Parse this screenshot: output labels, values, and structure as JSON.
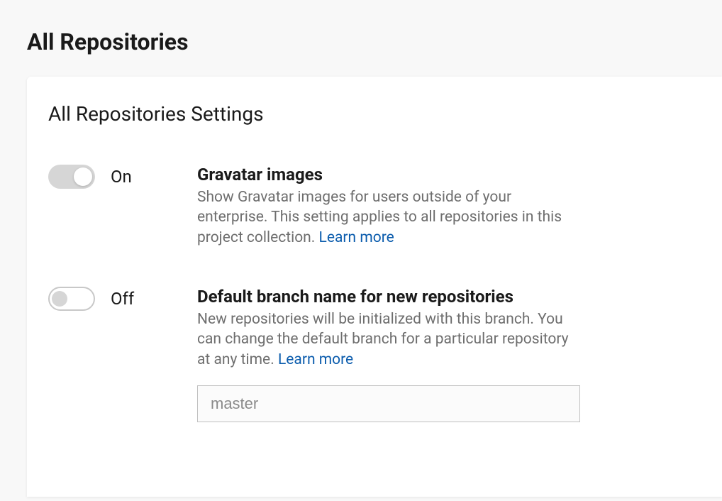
{
  "page": {
    "title": "All Repositories"
  },
  "card": {
    "title": "All Repositories Settings"
  },
  "settings": {
    "gravatar": {
      "toggle_state": "On",
      "title": "Gravatar images",
      "description": "Show Gravatar images for users outside of your enterprise. This setting applies to all repositories in this project collection. ",
      "learn_more": "Learn more"
    },
    "default_branch": {
      "toggle_state": "Off",
      "title": "Default branch name for new repositories",
      "description": "New repositories will be initialized with this branch. You can change the default branch for a particular repository at any time. ",
      "learn_more": "Learn more",
      "input_placeholder": "master",
      "input_value": ""
    }
  }
}
